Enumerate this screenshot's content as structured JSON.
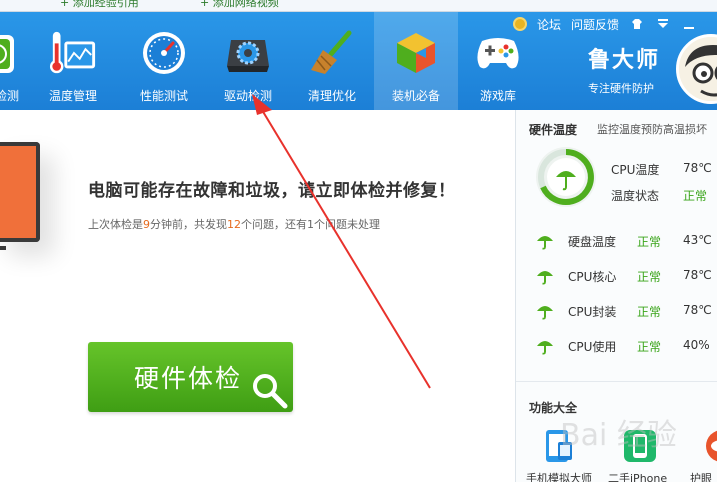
{
  "top_tabs": [
    "+ 添加经验引用",
    "+ 添加网络视频"
  ],
  "header": {
    "util_links": [
      "论坛",
      "问题反馈"
    ],
    "nav": [
      {
        "label": "检测",
        "icon": "hardware-icon"
      },
      {
        "label": "温度管理",
        "icon": "thermometer-icon"
      },
      {
        "label": "性能测试",
        "icon": "speedometer-icon"
      },
      {
        "label": "驱动检测",
        "icon": "driver-gear-icon"
      },
      {
        "label": "清理优化",
        "icon": "broom-icon"
      },
      {
        "label": "装机必备",
        "icon": "cube-icon"
      },
      {
        "label": "游戏库",
        "icon": "gamepad-icon"
      }
    ],
    "active_nav": "装机必备",
    "brand_name": "鲁大师",
    "brand_sub": "专注硬件防护"
  },
  "main": {
    "warning_title": "电脑可能存在故障和垃圾，请立即体检并修复！",
    "last_check": {
      "prefix": "上次体检是",
      "minutes": "9",
      "mid1": "分钟前，共发现",
      "problems": "12",
      "mid2": "个问题，还有",
      "remaining": "1",
      "suffix": "个问题未处理"
    },
    "check_button": "硬件体检"
  },
  "sidebar": {
    "title": "硬件温度",
    "subtitle": "监控温度预防高温损坏",
    "cpu_temp_label": "CPU温度",
    "cpu_temp_value": "78℃",
    "temp_state_label": "温度状态",
    "temp_state_value": "正常",
    "rows": [
      {
        "name": "硬盘温度",
        "status": "正常",
        "value": "43℃"
      },
      {
        "name": "CPU核心",
        "status": "正常",
        "value": "78℃"
      },
      {
        "name": "CPU封装",
        "status": "正常",
        "value": "78℃"
      },
      {
        "name": "CPU使用",
        "status": "正常",
        "value": "40%"
      }
    ],
    "functions_title": "功能大全",
    "functions": [
      {
        "label": "手机模拟大师",
        "icon": "phone-emulator-icon"
      },
      {
        "label": "二手iPhone",
        "icon": "iphone-icon"
      },
      {
        "label": "护眼",
        "icon": "eye-icon"
      }
    ]
  },
  "watermark": "Bai 经验",
  "colors": {
    "header_blue": "#1f86dc",
    "accent_green": "#4fae1e",
    "status_green": "#3aa51a",
    "highlight_orange": "#e56b1f",
    "arrow_red": "#e8322c"
  }
}
